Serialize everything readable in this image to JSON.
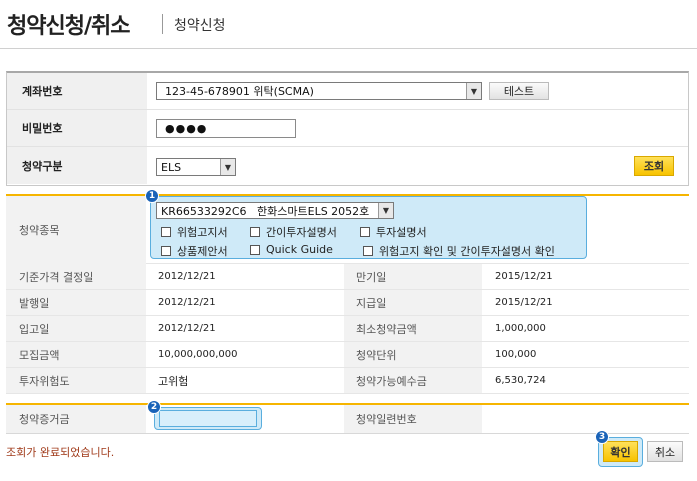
{
  "header": {
    "title": "청약신청/취소",
    "breadcrumb": "청약신청"
  },
  "query": {
    "account_label": "계좌번호",
    "account_value": "123-45-678901 위탁(SCMA)",
    "test_button": "테스트",
    "password_label": "비밀번호",
    "password_value": "●●●●",
    "type_label": "청약구분",
    "type_value": "ELS",
    "search_button": "조회"
  },
  "detail": {
    "product_label": "청약종목",
    "product_value": "KR66533292C6   한화스마트ELS 2052호",
    "checkboxes": [
      "위험고지서",
      "간이투자설명서",
      "투자설명서",
      "상품제안서",
      "Quick Guide",
      "위험고지 확인 및 간이투자설명서 확인"
    ],
    "rows": [
      {
        "l1": "기준가격 결정일",
        "v1": "2012/12/21",
        "l2": "만기일",
        "v2": "2015/12/21"
      },
      {
        "l1": "발행일",
        "v1": "2012/12/21",
        "l2": "지급일",
        "v2": "2015/12/21"
      },
      {
        "l1": "입고일",
        "v1": "2012/12/21",
        "l2": "최소청약금액",
        "v2": "1,000,000"
      },
      {
        "l1": "모집금액",
        "v1": "10,000,000,000",
        "l2": "청약단위",
        "v2": "100,000"
      },
      {
        "l1": "투자위험도",
        "v1": "고위험",
        "l2": "청약가능예수금",
        "v2": "6,530,724"
      }
    ],
    "deposit_label": "청약증거금",
    "deposit_value": "",
    "serial_label": "청약일련번호",
    "serial_value": ""
  },
  "footer": {
    "status": "조회가 완료되었습니다.",
    "confirm_button": "확인",
    "cancel_button": "취소"
  },
  "badges": [
    "1",
    "2",
    "3"
  ],
  "colors": {
    "accent_yellow": "#f6b500",
    "highlight_blue": "#cfeaf8",
    "badge_blue": "#1a63b8",
    "status_text": "#a03a1a"
  }
}
